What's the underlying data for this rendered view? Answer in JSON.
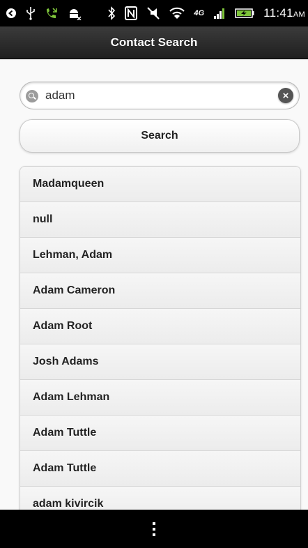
{
  "status_bar": {
    "icons": [
      "back-icon",
      "usb-icon",
      "missed-call-icon",
      "android-debug-icon",
      "bluetooth-icon",
      "nfc-icon",
      "no-sound-icon",
      "wifi-icon",
      "4g-icon",
      "signal-icon",
      "battery-icon"
    ],
    "time": "11:41",
    "ampm": "AM"
  },
  "header": {
    "title": "Contact Search"
  },
  "search": {
    "value": "adam",
    "button_label": "Search"
  },
  "results": [
    "Madamqueen",
    "null",
    "Lehman, Adam",
    "Adam Cameron",
    "Adam Root",
    "Josh Adams",
    "Adam Lehman",
    "Adam Tuttle",
    "Adam Tuttle",
    "adam kivircik"
  ],
  "navbar": {
    "icons": [
      "menu-icon"
    ]
  },
  "colors": {
    "header": "#2a2a2a",
    "background": "#f9f9f9",
    "list_item": "#eeeeee",
    "status_bar": "#000000"
  }
}
